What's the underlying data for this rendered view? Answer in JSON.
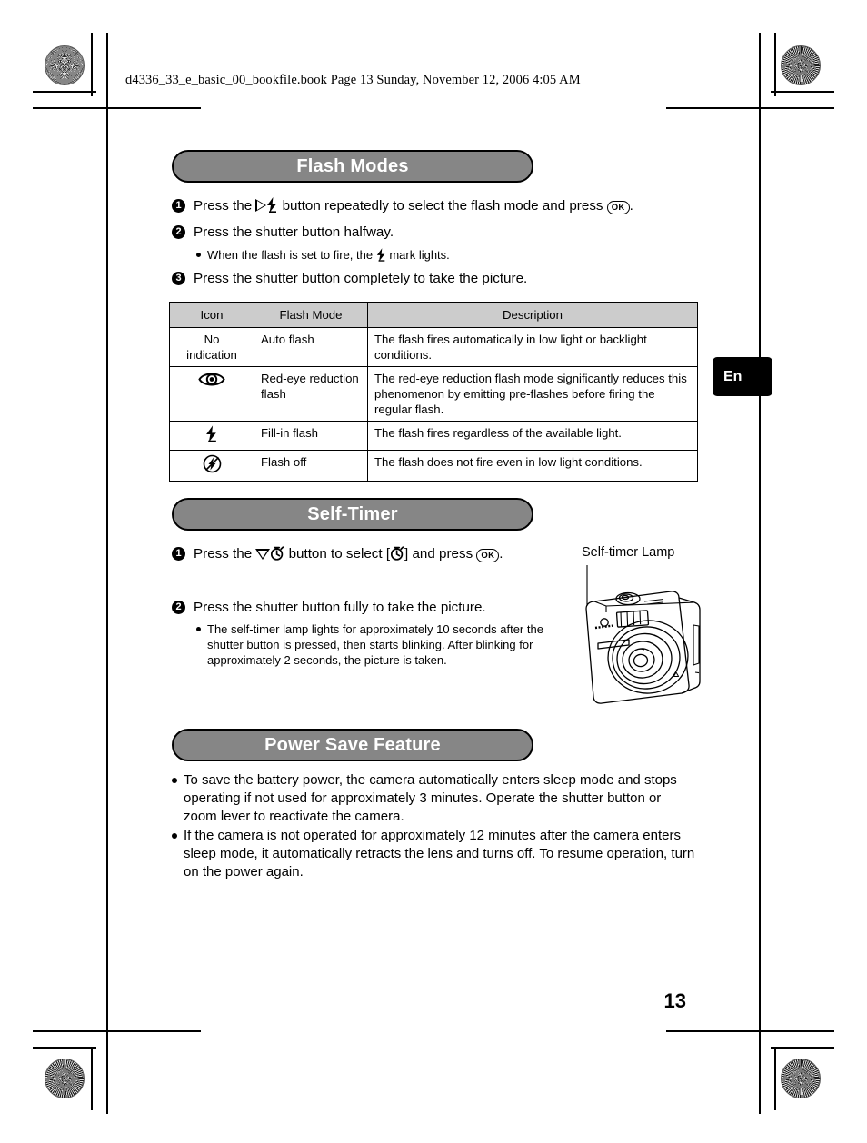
{
  "print_header": {
    "bookfile_line": "d4336_33_e_basic_00_bookfile.book  Page 13  Sunday, November 12, 2006  4:05 AM"
  },
  "language_tab": {
    "label": "En"
  },
  "page_number": "13",
  "sections": [
    {
      "id": "flash-modes",
      "title": "Flash Modes",
      "steps": [
        {
          "number": "1",
          "pre": "Press the ",
          "icons": [
            "triangle-right-icon",
            "flash-bolt-icon"
          ],
          "mid": " button repeatedly to select the flash mode and press ",
          "ok": "OK",
          "post": "."
        },
        {
          "number": "2",
          "pre": "Press the shutter button halfway.",
          "icons": [],
          "mid": "",
          "ok": "",
          "post": ""
        },
        {
          "number": "3",
          "pre": "Press the shutter button completely to take the picture.",
          "icons": [],
          "mid": "",
          "ok": "",
          "post": ""
        }
      ],
      "bullet": {
        "pre": "When the flash is set to fire, the ",
        "icon": "flash-bolt-icon",
        "post": " mark lights."
      }
    },
    {
      "id": "self-timer",
      "title": "Self-Timer",
      "steps": [
        {
          "number": "1",
          "pre": "Press the ",
          "icons": [
            "triangle-down-icon",
            "self-timer-icon"
          ],
          "mid": " button to select [",
          "icon2": "self-timer-icon",
          "mid2": "] and press ",
          "ok": "OK",
          "post": "."
        },
        {
          "number": "2",
          "pre": "Press the shutter button fully to take the picture.",
          "icons": [],
          "mid": "",
          "ok": "",
          "post": ""
        }
      ],
      "bullet_text": "The self-timer lamp lights for approximately 10 seconds after the shutter button is pressed, then starts blinking. After blinking for approximately 2 seconds, the picture is taken."
    },
    {
      "id": "power-save-feature",
      "title": "Power Save Feature",
      "bullets": [
        "To save the battery power, the camera automatically enters sleep mode and stops operating if not used for approximately 3 minutes. Operate the shutter button or zoom lever to reactivate the camera.",
        "If the camera is not operated for approximately 12 minutes after the camera enters sleep mode, it automatically retracts the lens and turns off. To resume operation, turn on the power again."
      ]
    }
  ],
  "flash_table": {
    "headers": [
      "Icon",
      "Flash Mode",
      "Description"
    ],
    "rows": [
      {
        "icon_kind": "text",
        "icon_text": "No\nindication",
        "icon_name": "no-indication-text",
        "mode": "Auto flash",
        "description": "The flash fires automatically in low light or backlight conditions."
      },
      {
        "icon_kind": "glyph",
        "icon_text": "",
        "icon_name": "red-eye-reduction-icon",
        "mode": "Red-eye reduction flash",
        "description": "The red-eye reduction flash mode significantly reduces this phenomenon by emitting pre-flashes before firing the regular flash."
      },
      {
        "icon_kind": "glyph",
        "icon_text": "",
        "icon_name": "fill-in-flash-icon",
        "mode": "Fill-in flash",
        "description": "The flash fires regardless of the available light."
      },
      {
        "icon_kind": "glyph",
        "icon_text": "",
        "icon_name": "flash-off-icon",
        "mode": "Flash off",
        "description": "The flash does not fire even in low light conditions."
      }
    ]
  },
  "figure": {
    "caption": "Self-timer Lamp",
    "alt": "camera-illustration"
  },
  "colors": {
    "section_bar_fill": "#868686",
    "table_header_fill": "#cccccc",
    "tab_fill": "#000000",
    "text": "#000000"
  }
}
